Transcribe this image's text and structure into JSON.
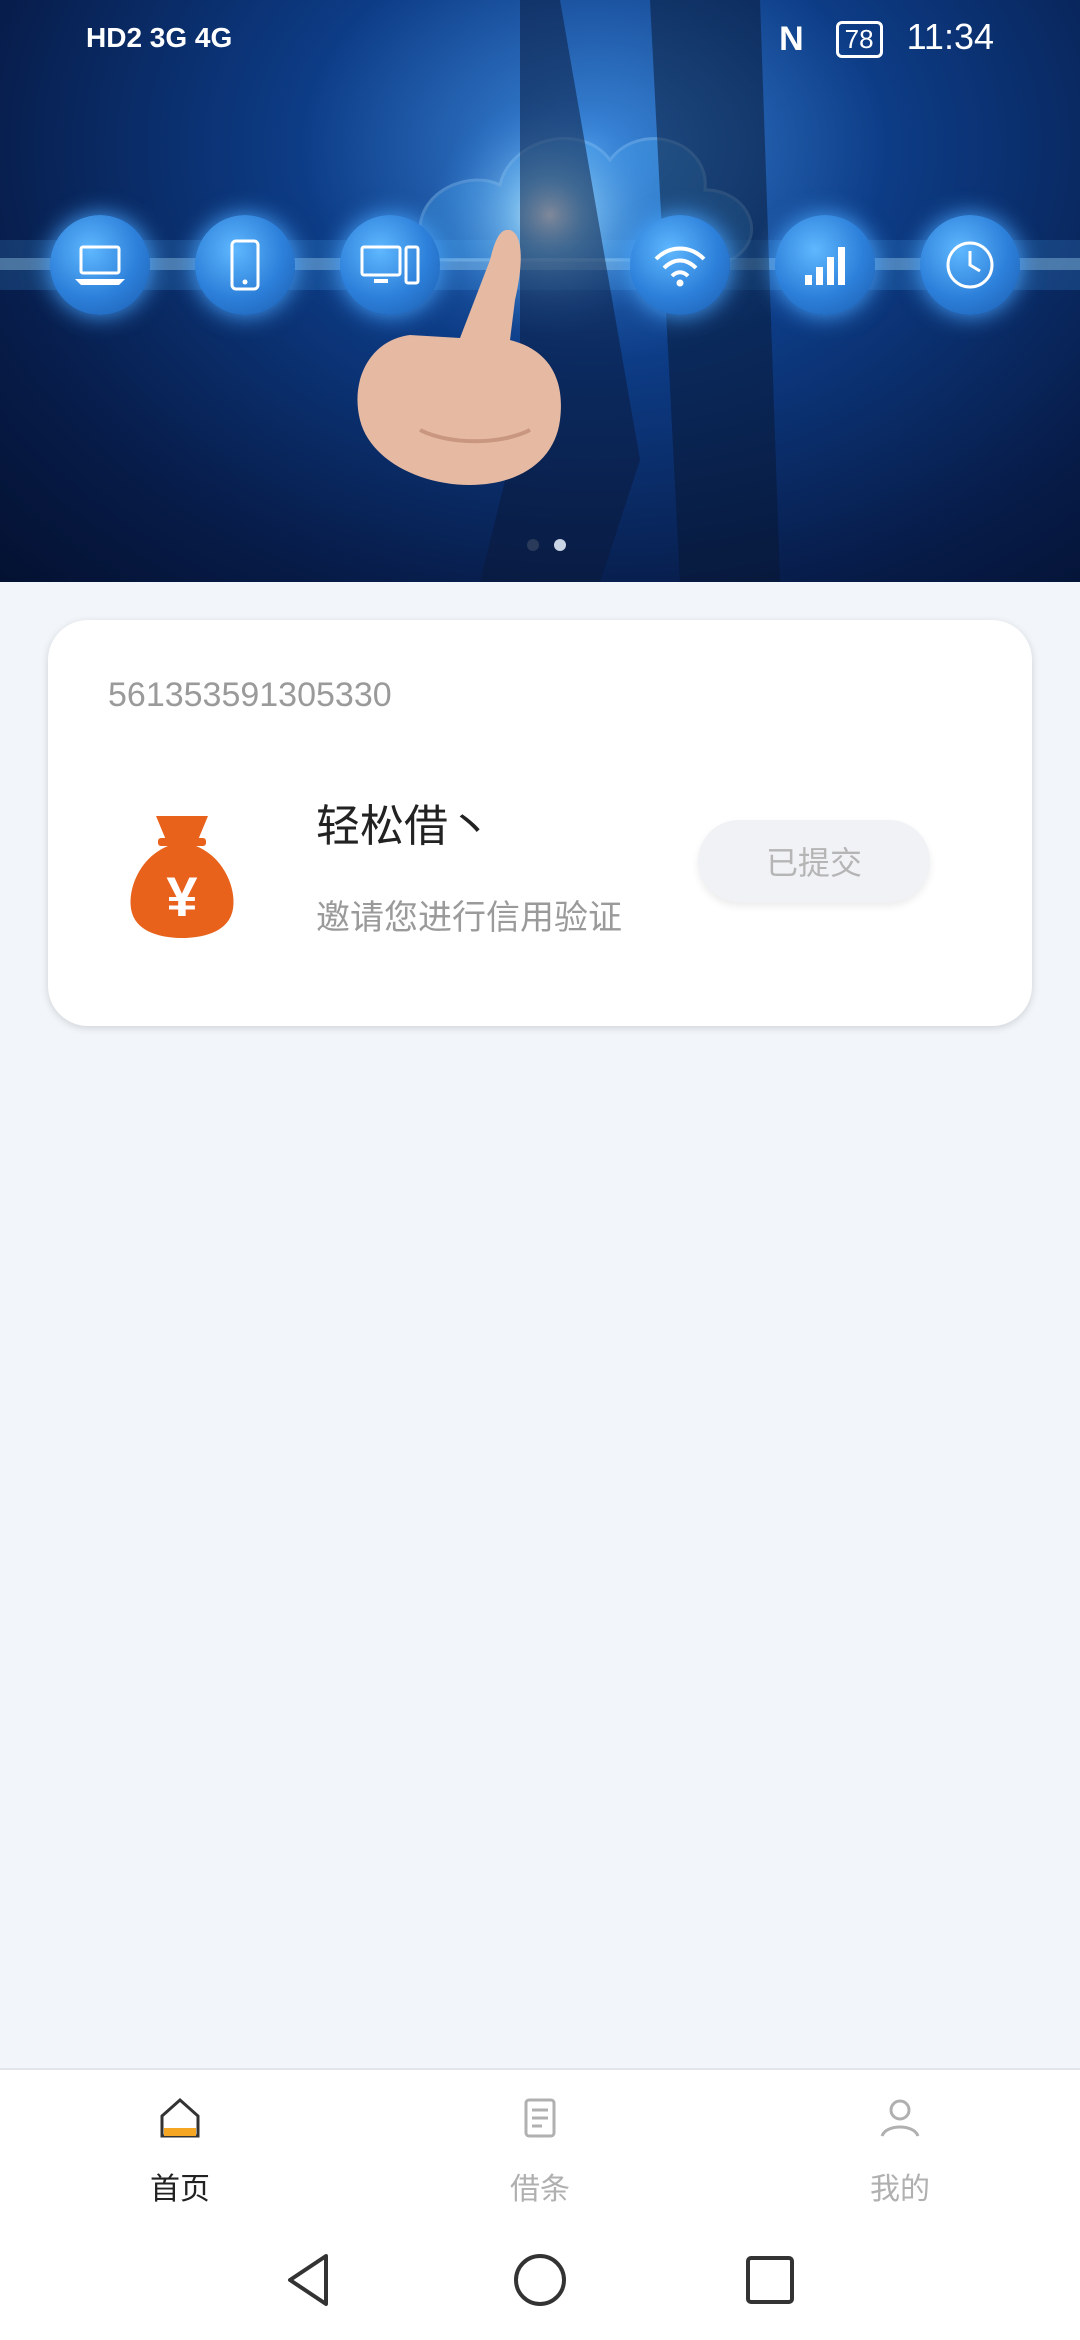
{
  "status_bar": {
    "network_left": "HD2 3G 4G",
    "nfc": "N",
    "battery": "78",
    "time": "11:34"
  },
  "banner": {
    "slides_total": 2,
    "active_slide": 2,
    "icons": [
      "laptop-icon",
      "phone-icon",
      "desktop-icon",
      "wifi-icon",
      "signal-icon",
      "clock-icon"
    ]
  },
  "card": {
    "id_number": "561353591305330",
    "title": "轻松借丶",
    "subtitle": "邀请您进行信用验证",
    "status_button": "已提交",
    "logo_symbol": "¥",
    "accent_color": "#e8621c"
  },
  "tabbar": {
    "tabs": [
      {
        "label": "首页",
        "icon": "home-icon",
        "active": true
      },
      {
        "label": "借条",
        "icon": "document-icon",
        "active": false
      },
      {
        "label": "我的",
        "icon": "user-icon",
        "active": false
      }
    ]
  },
  "nav": [
    "back-icon",
    "home-circle-icon",
    "recents-icon"
  ]
}
